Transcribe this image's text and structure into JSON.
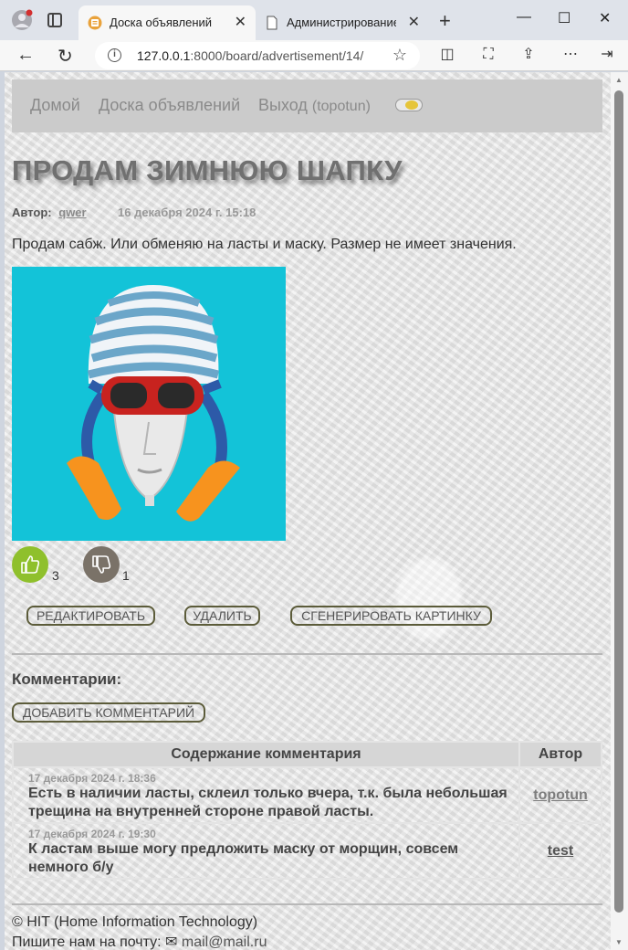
{
  "browser": {
    "tabs": [
      {
        "title": "Доска объявлений",
        "active": true
      },
      {
        "title": "Администрирование са",
        "active": false
      }
    ],
    "url_host": "127.0.0.1",
    "url_rest": ":8000/board/advertisement/14/"
  },
  "nav": {
    "home": "Домой",
    "board": "Доска объявлений",
    "logout": "Выход",
    "username": "(topotun)"
  },
  "ad": {
    "title": "ПРОДАМ ЗИМНЮЮ ШАПКУ",
    "author_label": "Автор:",
    "author": "qwer",
    "date": "16 декабря 2024 г. 15:18",
    "description": "Продам сабж. Или обменяю на ласты и маску. Размер не имеет значения.",
    "likes": "3",
    "dislikes": "1"
  },
  "actions": {
    "edit": "РЕДАКТИРОВАТЬ",
    "delete": "УДАЛИТЬ",
    "generate": "СГЕНЕРИРОВАТЬ КАРТИНКУ"
  },
  "comments": {
    "title": "Комментарии:",
    "add": "ДОБАВИТЬ КОММЕНТАРИЙ",
    "col_content": "Содержание комментария",
    "col_author": "Автор",
    "rows": [
      {
        "date": "17 декабря 2024 г. 18:36",
        "text": "Есть в наличии ласты, склеил только вчера, т.к. была небольшая трещина на внутренней стороне правой ласты.",
        "author": "topotun"
      },
      {
        "date": "17 декабря 2024 г. 19:30",
        "text": "К ластам выше могу предложить маску от морщин, совсем немного б/у",
        "author": "test"
      }
    ]
  },
  "footer": {
    "copyright": "© HIT (Home Information Technology)",
    "mail_prefix": "Пишите нам на почту:",
    "mail": "mail@mail.ru"
  },
  "colors": {
    "like": "#8fc02c",
    "dislike": "#7a7268",
    "photo_bg": "#13c3d8"
  }
}
